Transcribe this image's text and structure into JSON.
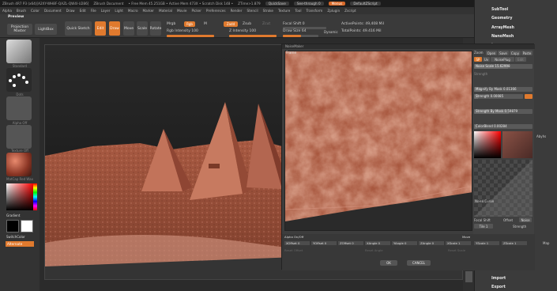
{
  "titlebar": {
    "app": "ZBrush 4R7 P3 (x64)[A2XY-WH8F-QAZL-QW4I-U286]",
    "document": "ZBrush Document",
    "mem": "• Free Mem 45.251GB • Active Mem 473X • Scratch Disk 148 •",
    "ztime": "ZTime>1.879",
    "quicksave": "QuickSave",
    "seethrough": "See-through  0",
    "menus": "Menus",
    "defaultscript": "DefaultZScript"
  },
  "menubar": [
    "Alpha",
    "Brush",
    "Color",
    "Document",
    "Draw",
    "Edit",
    "File",
    "Layer",
    "Light",
    "Macro",
    "Marker",
    "Material",
    "Movie",
    "Picker",
    "Preferences",
    "Render",
    "Stencil",
    "Stroke",
    "Texture",
    "Tool",
    "Transform",
    "Zplugin",
    "Zscript"
  ],
  "toolbar": {
    "preview": "Preview",
    "projection_master": "Projection Master",
    "lightbox": "LightBox",
    "quick_sketch": "Quick Sketch",
    "edit": "Edit",
    "draw": "Draw",
    "move": "Move",
    "scale": "Scale",
    "rotate": "Rotate",
    "mrgb": "Mrgb",
    "rgb": "Rgb",
    "rgb_btn": "Rgb",
    "m": "M",
    "zadd": "Zadd",
    "zsub": "Zsub",
    "zcut": "Zcut",
    "rgb_intensity": "Rgb  Intensity 100",
    "z_intensity": "Z  Intensity 100",
    "focal_shift": "Focal Shift 0",
    "draw_size": "Draw Size 64",
    "dynamic": "Dynamic",
    "active_points": "ActivePoints: 49,408 Mil",
    "total_points": "TotalPoints: 49.416 Mil",
    "rgb_intensity_value": 1.0,
    "z_intensity_value": 1.0,
    "draw_size_value": 0.5
  },
  "left_shelf": {
    "labels": [
      "Standard",
      "Dots",
      "Alpha Off",
      "Texture Off",
      "MatCap Red Wax"
    ],
    "gradient": "Gradient",
    "switch_color": "SwitchColor",
    "alternate": "Alternate"
  },
  "right_panel": {
    "items": [
      "SubTool",
      "Geometry",
      "ArrayMesh",
      "NanoMesh",
      "Layers"
    ],
    "bottom_items": [
      "Initialize",
      "Import",
      "Export"
    ],
    "fragment": "Map",
    "fragment2": "Abyhs"
  },
  "dialog": {
    "title": "NoiseMaker",
    "frame_label": "Frame",
    "zoom_label": "Zoom",
    "open": "Open",
    "save": "Save",
    "copy": "Copy",
    "paste": "Paste",
    "sp": "SP",
    "uv": "Uv",
    "noise_plug": "NoisePlug",
    "edit": "Edit",
    "noise_scale": "Noise Scale  15.62998",
    "strength": "Strength",
    "magnify": "Magnify By Mask  0.01366",
    "strength_val": "Strength  0.00085",
    "strength_mask": "Strength By Mask  0.59879",
    "color_blend": "ColorBlend  0.00284",
    "noise_curve": "Noise Curve",
    "focal_shift": "Focal Shift",
    "offset": "Offset",
    "noise": "Noise",
    "tile": "Tile 1",
    "strength2": "Strength",
    "alpha_label": "Alpha On/Off",
    "fields": [
      "XOffset 0",
      "YOffset 0",
      "ZOffset 0",
      "XAngle 0",
      "YAngle 0",
      "ZAngle 0",
      "XScale 1",
      "YScale 1",
      "ZScale 1"
    ],
    "ok": "OK",
    "cancel": "CANCEL",
    "move": "Move",
    "reset_offset": "Reset Offset",
    "reset_angle": "Reset Angle",
    "reset_scale": "Reset Scale",
    "noise_scale_value": 0.58,
    "magnify_value": 0.12,
    "strength_value": 0.08,
    "strength_mask_value": 0.6,
    "color_blend_value": 0.05,
    "colors": {
      "accent": "#e07a2e",
      "terrain": "#b86a50"
    }
  }
}
